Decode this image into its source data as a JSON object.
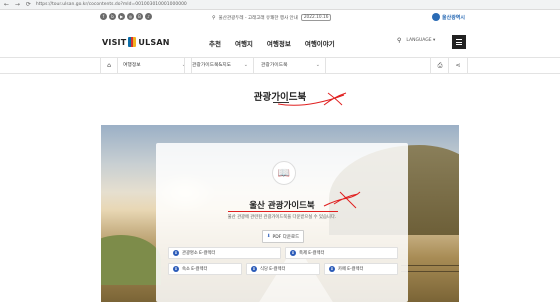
{
  "browser": {
    "nav": "← → ⟳",
    "url": "https://tour.ulsan.go.kr/cocontents.do?mId=001003010001000000"
  },
  "utility": {
    "social": [
      "f",
      "b",
      "▶",
      "◎",
      "B",
      "♪"
    ],
    "notice": "울산관광두레 - 고래고래 유쾌한 행사 안내",
    "notice_date": "2022.10.16",
    "city_logo": "울산광역시"
  },
  "header": {
    "logo_left": "VISIT",
    "logo_right": "ULSAN",
    "nav": [
      "추천",
      "여행지",
      "여행정보",
      "여행이야기"
    ],
    "language": "LANGUAGE ▾"
  },
  "breadcrumb": [
    "여행정보",
    "관광가이드북&지도",
    "관광가이드북"
  ],
  "page_title": "관광가이드북",
  "card": {
    "title": "울산 관광가이드북",
    "description": "울산 관광에 관련된 관광가이드북을 다운받으실 수 있습니다.",
    "pdf_label": "PDF 다운로드",
    "rows": [
      [
        "관광명소 E-컬렉터",
        "축제 E-컬렉터"
      ],
      [
        "숙소 E-컬렉터",
        "식당 E-컬렉터",
        "카페 E-컬렉터"
      ]
    ]
  },
  "colors": {
    "accent": "#2a5ab8",
    "brand_blue": "#1c3f94"
  }
}
